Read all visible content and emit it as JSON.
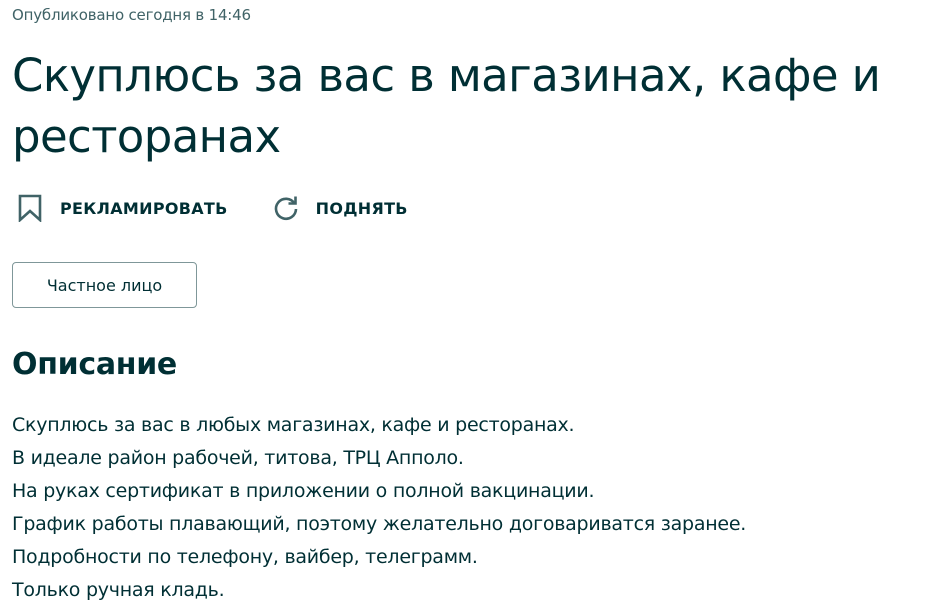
{
  "listing": {
    "published": "Опубликовано сегодня в 14:46",
    "title": "Скуплюсь за вас в магазинах, кафе и ресторанах"
  },
  "actions": {
    "promote": {
      "label": "РЕКЛАМИРОВАТЬ",
      "icon": "bookmark-icon"
    },
    "bump": {
      "label": "ПОДНЯТЬ",
      "icon": "refresh-icon"
    }
  },
  "seller": {
    "type_label": "Частное лицо"
  },
  "description": {
    "heading": "Описание",
    "lines": [
      "Скуплюсь за вас в любых магазинах, кафе и ресторанах.",
      "В идеале район рабочей, титова, ТРЦ Апполо.",
      "На руках сертификат в приложении о полной вакцинации.",
      "График работы плавающий, поэтому желательно договариватся заранее.",
      "Подробности по телефону, вайбер, телеграмм.",
      "Только ручная кладь."
    ]
  },
  "colors": {
    "text": "#002f34",
    "muted": "#406367",
    "border": "#7f9799"
  }
}
